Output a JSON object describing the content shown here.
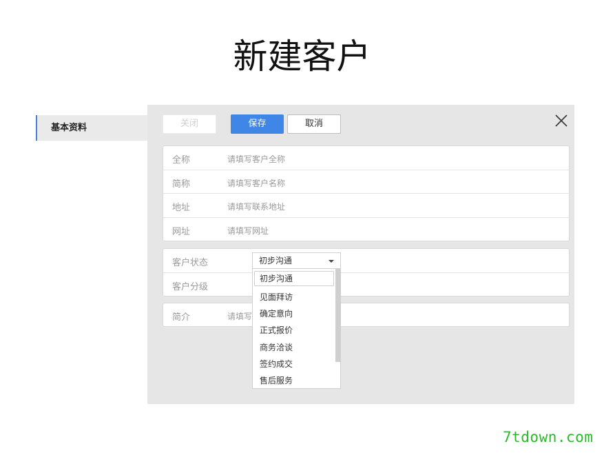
{
  "page": {
    "title": "新建客户"
  },
  "sidebar": {
    "tab_label": "基本资料"
  },
  "toolbar": {
    "close_label": "关闭",
    "save_label": "保存",
    "cancel_label": "取消"
  },
  "basic_fields": [
    {
      "label": "全称",
      "placeholder": "请填写客户全称"
    },
    {
      "label": "简称",
      "placeholder": "请填写客户名称"
    },
    {
      "label": "地址",
      "placeholder": "请填写联系地址"
    },
    {
      "label": "网址",
      "placeholder": "请填写网址"
    }
  ],
  "status_fields": {
    "status_label": "客户状态",
    "status_value": "初步沟通",
    "grade_label": "客户分级"
  },
  "intro_field": {
    "label": "简介",
    "placeholder_visible": "请填写"
  },
  "dropdown_options": [
    "初步沟通",
    "见面拜访",
    "确定意向",
    "正式报价",
    "商务洽谈",
    "签约成交",
    "售后服务"
  ],
  "watermark": "7tdown.com",
  "colors": {
    "primary": "#3f86e6",
    "panel_bg": "#e6e6e6",
    "tab_accent": "#4a7fd8",
    "watermark": "#2bb82b"
  }
}
